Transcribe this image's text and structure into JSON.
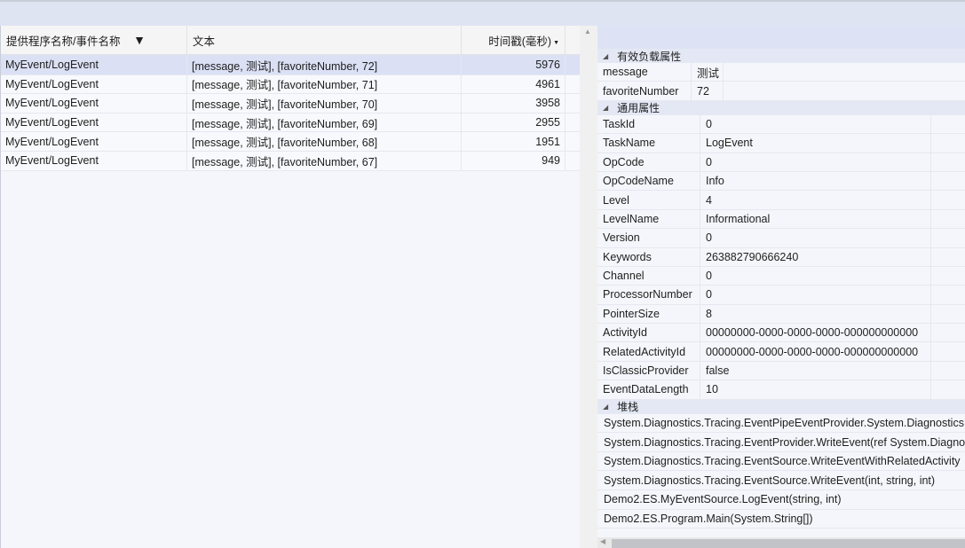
{
  "table": {
    "columns": [
      "提供程序名称/事件名称",
      "文本",
      "时间戳(毫秒)"
    ],
    "rows": [
      [
        "MyEvent/LogEvent",
        "[message, 测试], [favoriteNumber, 72]",
        "5976"
      ],
      [
        "MyEvent/LogEvent",
        "[message, 测试], [favoriteNumber, 71]",
        "4961"
      ],
      [
        "MyEvent/LogEvent",
        "[message, 测试], [favoriteNumber, 70]",
        "3958"
      ],
      [
        "MyEvent/LogEvent",
        "[message, 测试], [favoriteNumber, 69]",
        "2955"
      ],
      [
        "MyEvent/LogEvent",
        "[message, 测试], [favoriteNumber, 68]",
        "1951"
      ],
      [
        "MyEvent/LogEvent",
        "[message, 测试], [favoriteNumber, 67]",
        "949"
      ]
    ]
  },
  "details": {
    "payload_title": "有效负载属性",
    "payload": [
      [
        "message",
        "测试"
      ],
      [
        "favoriteNumber",
        "72"
      ]
    ],
    "common_title": "通用属性",
    "common": [
      [
        "TaskId",
        "0"
      ],
      [
        "TaskName",
        "LogEvent"
      ],
      [
        "OpCode",
        "0"
      ],
      [
        "OpCodeName",
        "Info"
      ],
      [
        "Level",
        "4"
      ],
      [
        "LevelName",
        "Informational"
      ],
      [
        "Version",
        "0"
      ],
      [
        "Keywords",
        "263882790666240"
      ],
      [
        "Channel",
        "0"
      ],
      [
        "ProcessorNumber",
        "0"
      ],
      [
        "PointerSize",
        "8"
      ],
      [
        "ActivityId",
        "00000000-0000-0000-0000-000000000000"
      ],
      [
        "RelatedActivityId",
        "00000000-0000-0000-0000-000000000000"
      ],
      [
        "IsClassicProvider",
        "false"
      ],
      [
        "EventDataLength",
        "10"
      ]
    ],
    "stack_title": "堆栈",
    "stack": [
      "System.Diagnostics.Tracing.EventPipeEventProvider.System.Diagnostics.",
      "System.Diagnostics.Tracing.EventProvider.WriteEvent(ref System.Diagno",
      "System.Diagnostics.Tracing.EventSource.WriteEventWithRelatedActivity",
      "System.Diagnostics.Tracing.EventSource.WriteEvent(int, string, int)",
      "Demo2.ES.MyEventSource.LogEvent(string, int)",
      "Demo2.ES.Program.Main(System.String[])"
    ]
  }
}
